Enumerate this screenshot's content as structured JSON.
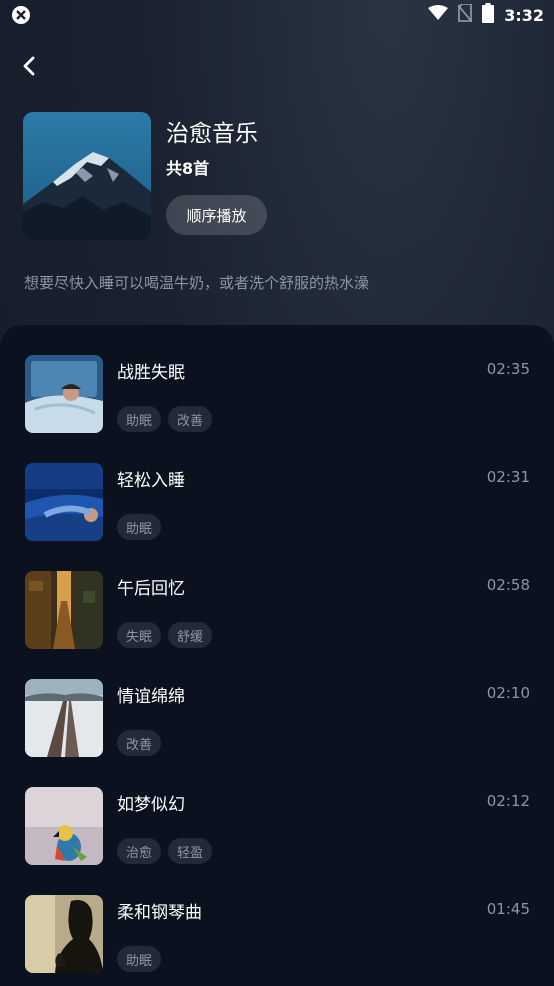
{
  "status_bar": {
    "time": "3:32",
    "icons": [
      "app-notification-icon",
      "wifi-icon",
      "no-sim-icon",
      "battery-icon"
    ]
  },
  "header": {
    "back_icon": "chevron-left-icon",
    "title": "治愈音乐",
    "count": "共8首",
    "play_button": "顺序播放",
    "description": "想要尽快入睡可以喝温牛奶，或者洗个舒服的热水澡"
  },
  "tracks": [
    {
      "title": "战胜失眠",
      "duration": "02:35",
      "tags": [
        "助眠",
        "改善"
      ]
    },
    {
      "title": "轻松入睡",
      "duration": "02:31",
      "tags": [
        "助眠"
      ]
    },
    {
      "title": "午后回忆",
      "duration": "02:58",
      "tags": [
        "失眠",
        "舒缓"
      ]
    },
    {
      "title": "情谊绵绵",
      "duration": "02:10",
      "tags": [
        "改善"
      ]
    },
    {
      "title": "如梦似幻",
      "duration": "02:12",
      "tags": [
        "治愈",
        "轻盈"
      ]
    },
    {
      "title": "柔和钢琴曲",
      "duration": "01:45",
      "tags": [
        "助眠"
      ]
    }
  ],
  "colors": {
    "background": "#141b27",
    "list_background": "#0c1120",
    "tag_background": "#222a38",
    "muted_text": "#8c95a3"
  }
}
